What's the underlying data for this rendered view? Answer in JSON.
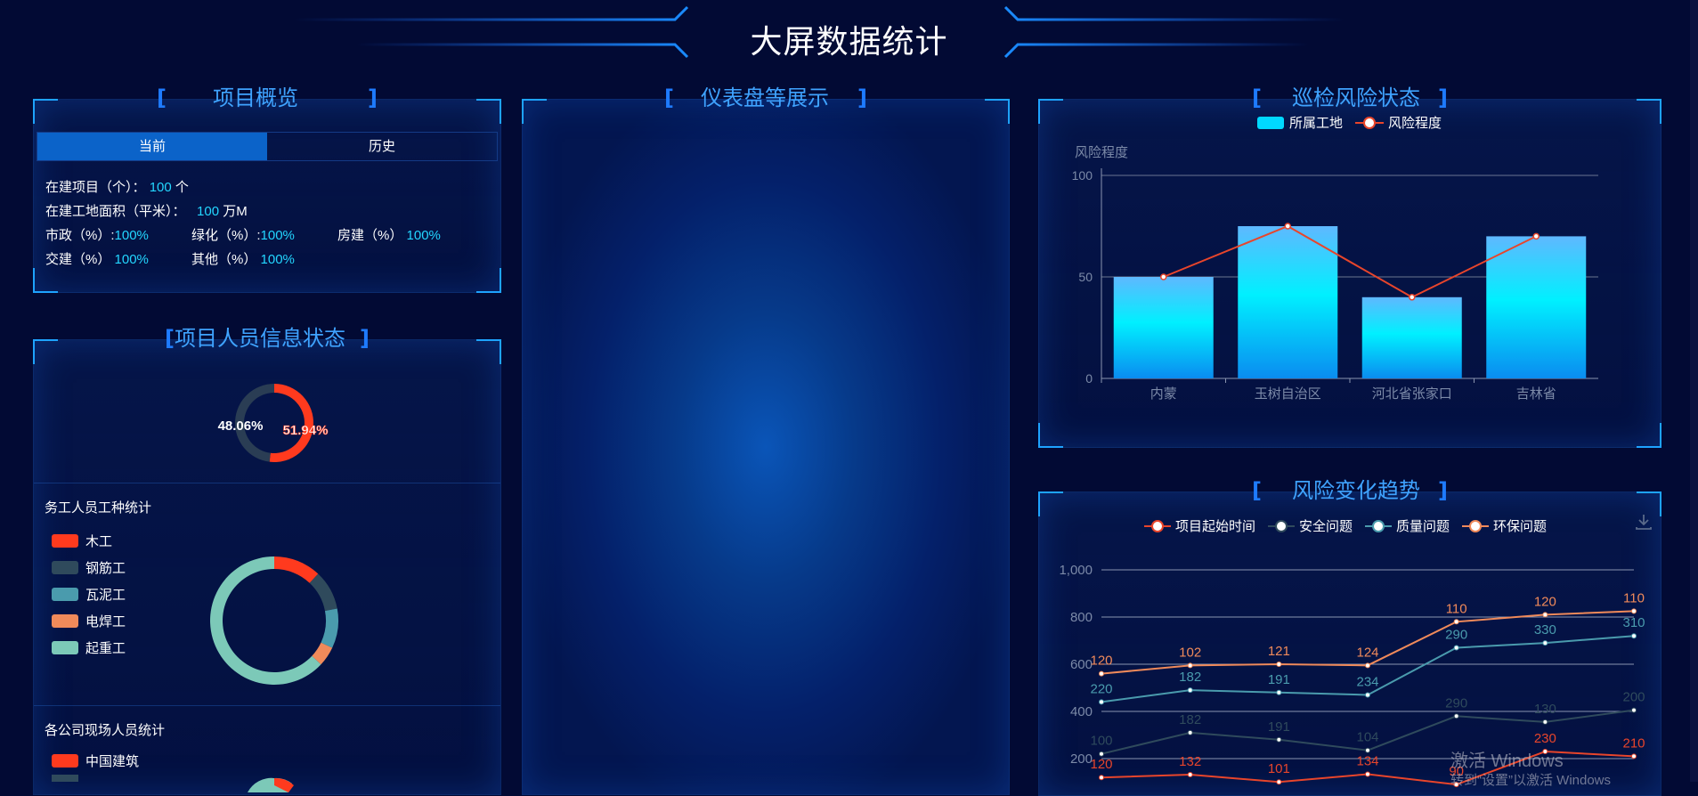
{
  "header": {
    "title": "大屏数据统计"
  },
  "overview": {
    "title": "项目概览",
    "tabs": [
      {
        "label": "当前",
        "active": true
      },
      {
        "label": "历史",
        "active": false
      }
    ],
    "stats": {
      "projects_label": "在建项目（个）：",
      "projects_value": "100",
      "projects_unit": "个",
      "area_label": "在建工地面积（平米）：",
      "area_value": "100",
      "area_unit": "万M",
      "municipal_label": "市政（%）:",
      "municipal_value": "100%",
      "greening_label": "绿化（%）:",
      "greening_value": "100%",
      "housing_label": "房建（%）",
      "housing_value": "100%",
      "traffic_label": "交建（%）",
      "traffic_value": "100%",
      "other_label": "其他（%）",
      "other_value": "100%"
    }
  },
  "personnel": {
    "title": "项目人员信息状态",
    "ratio_chart": {
      "left_label": "48.06%",
      "right_label": "51.94%",
      "values": [
        48.06,
        51.94
      ],
      "colors": [
        "#2a3d54",
        "#ff3a1e"
      ]
    },
    "work_type": {
      "title": "务工人员工种统计",
      "items": [
        {
          "label": "木工",
          "color": "#ff3a1e",
          "value": 12
        },
        {
          "label": "钢筋工",
          "color": "#2f4a5c",
          "value": 10
        },
        {
          "label": "瓦泥工",
          "color": "#4a9bad",
          "value": 10
        },
        {
          "label": "电焊工",
          "color": "#f08a5a",
          "value": 5
        },
        {
          "label": "起重工",
          "color": "#7cc9b8",
          "value": 63
        }
      ]
    },
    "company": {
      "title": "各公司现场人员统计",
      "items": [
        {
          "label": "中国建筑",
          "color": "#ff3a1e"
        }
      ]
    }
  },
  "dashboard": {
    "title": "仪表盘等展示"
  },
  "risk_status": {
    "title": "巡检风险状态",
    "legend": {
      "bar": "所属工地",
      "line": "风险程度"
    },
    "colors": {
      "bar_top": "#5fb8ff",
      "bar_mid": "#00f0ff",
      "bar_bottom": "#0a8cf0",
      "line": "#e8452b"
    }
  },
  "risk_trend": {
    "title": "风险变化趋势",
    "legend": [
      "项目起始时间",
      "安全问题",
      "质量问题",
      "环保问题"
    ]
  },
  "watermark": {
    "line1": "激活 Windows",
    "line2": "转到“设置”以激活 Windows"
  },
  "chart_data": [
    {
      "type": "bar",
      "ylabel": "风险程度",
      "categories": [
        "内蒙",
        "玉树自治区",
        "河北省张家口",
        "吉林省"
      ],
      "series": [
        {
          "name": "所属工地",
          "type": "bar",
          "values": [
            50,
            75,
            40,
            70
          ]
        },
        {
          "name": "风险程度",
          "type": "line",
          "values": [
            50,
            75,
            40,
            70
          ]
        }
      ],
      "ylim": [
        0,
        100
      ],
      "yticks": [
        0,
        50,
        100
      ],
      "grid": true,
      "legend": "top-center"
    },
    {
      "type": "line",
      "x": [
        1,
        2,
        3,
        4,
        5,
        6,
        7
      ],
      "ylim": [
        0,
        1000
      ],
      "yticks": [
        200,
        400,
        600,
        800,
        1000
      ],
      "ytick_labels": [
        "200",
        "400",
        "600",
        "800",
        "1,000"
      ],
      "grid": true,
      "legend": "top-center",
      "series": [
        {
          "name": "项目起始时间",
          "color": "#e8452b",
          "values": [
            120,
            132,
            101,
            134,
            90,
            230,
            210
          ],
          "labels": [
            "120",
            "132",
            "101",
            "134",
            "90",
            "230",
            "210"
          ]
        },
        {
          "name": "安全问题",
          "color": "#2f4a5c",
          "values": [
            220,
            310,
            280,
            235,
            380,
            355,
            405
          ],
          "labels": [
            "100",
            "182",
            "191",
            "104",
            "290",
            "130",
            "200"
          ]
        },
        {
          "name": "质量问题",
          "color": "#4a9bad",
          "values": [
            440,
            490,
            480,
            470,
            670,
            690,
            720
          ],
          "labels": [
            "220",
            "182",
            "191",
            "234",
            "290",
            "330",
            "310"
          ]
        },
        {
          "name": "环保问题",
          "color": "#f08a5a",
          "values": [
            560,
            595,
            600,
            595,
            780,
            810,
            825
          ],
          "labels": [
            "120",
            "102",
            "121",
            "124",
            "110",
            "120",
            "110"
          ]
        }
      ]
    }
  ]
}
